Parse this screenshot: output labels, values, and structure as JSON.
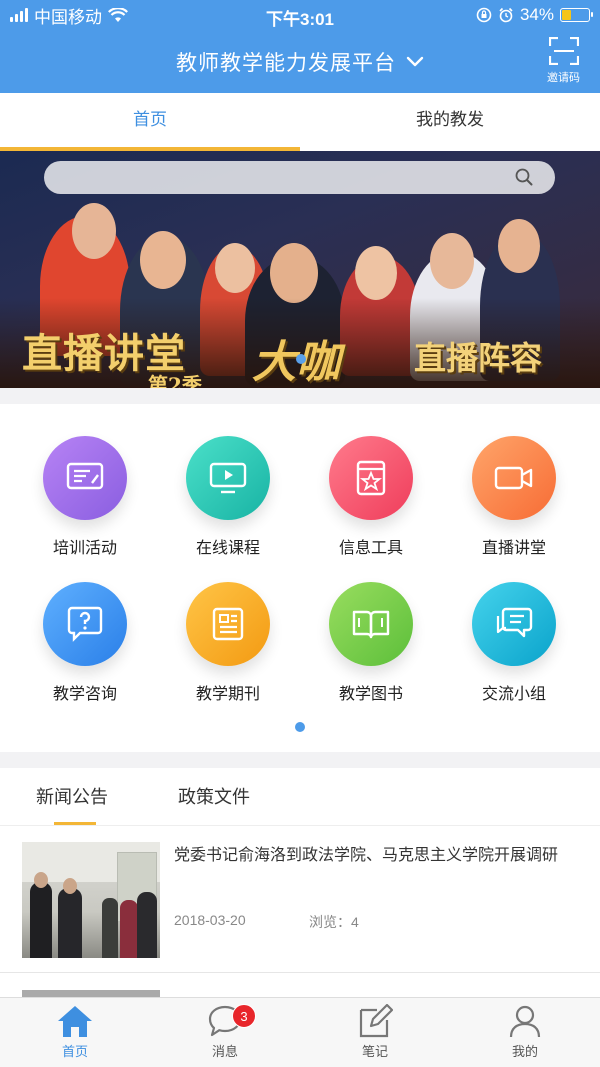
{
  "status_bar": {
    "carrier": "中国移动",
    "time": "下午3:01",
    "battery": "34%",
    "battery_level": 0.34
  },
  "header": {
    "title": "教师教学能力发展平台",
    "scan_label": "邀请码"
  },
  "tabs": [
    {
      "label": "首页",
      "active": true
    },
    {
      "label": "我的教发",
      "active": false
    }
  ],
  "banner": {
    "line1": "直播讲堂",
    "line2": "大咖",
    "line3": "直播阵容",
    "season": "第2季"
  },
  "grid": [
    {
      "label": "培训活动",
      "icon": "training-icon",
      "color": "#9a6ee9"
    },
    {
      "label": "在线课程",
      "icon": "video-screen-icon",
      "color": "#23c8b6"
    },
    {
      "label": "信息工具",
      "icon": "toolbook-icon",
      "color": "#f4506a"
    },
    {
      "label": "直播讲堂",
      "icon": "camera-icon",
      "color": "#f98248"
    },
    {
      "label": "教学咨询",
      "icon": "question-chat-icon",
      "color": "#3a92ef"
    },
    {
      "label": "教学期刊",
      "icon": "journal-icon",
      "color": "#f6a81b"
    },
    {
      "label": "教学图书",
      "icon": "book-icon",
      "color": "#7bcf48"
    },
    {
      "label": "交流小组",
      "icon": "group-chat-icon",
      "color": "#19b7d6"
    }
  ],
  "news": {
    "tabs": [
      {
        "label": "新闻公告",
        "active": true
      },
      {
        "label": "政策文件",
        "active": false
      }
    ],
    "items": [
      {
        "title": "党委书记俞海洛到政法学院、马克思主义学院开展调研",
        "date": "2018-03-20",
        "views": "浏览：4"
      }
    ]
  },
  "tabbar": [
    {
      "label": "首页",
      "icon": "home-icon",
      "active": true
    },
    {
      "label": "消息",
      "icon": "message-icon",
      "active": false,
      "badge": "3"
    },
    {
      "label": "笔记",
      "icon": "note-icon",
      "active": false
    },
    {
      "label": "我的",
      "icon": "profile-icon",
      "active": false
    }
  ]
}
